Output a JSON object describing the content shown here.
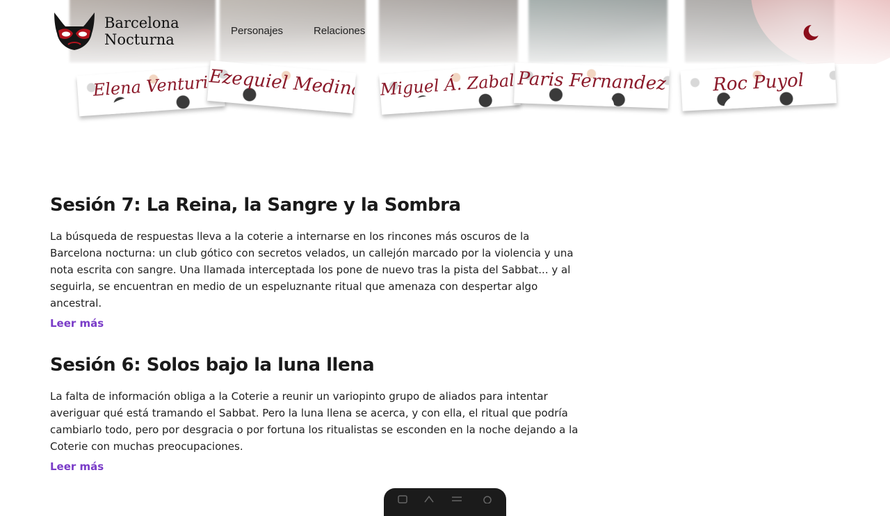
{
  "header": {
    "brand_line1": "Barcelona",
    "brand_line2": "Nocturna",
    "nav": [
      "Personajes",
      "Relaciones"
    ],
    "theme_toggle_icon": "moon-icon",
    "accent_color": "#8b0d1a"
  },
  "characters": [
    "Elena Venturi",
    "Ezequiel Medina",
    "Miguel Á. Zabaleta",
    "Paris Fernandez",
    "Roc Puyol"
  ],
  "articles": [
    {
      "title": "Sesión 7: La Reina, la Sangre y la Sombra",
      "summary": "La búsqueda de respuestas lleva a la coterie a internarse en los rincones más oscuros de la Barcelona nocturna: un club gótico con secretos velados, un callejón marcado por la violencia y una nota escrita con sangre. Una llamada interceptada los pone de nuevo tras la pista del Sabbat... y al seguirla, se encuentran en medio de un espeluznante ritual que amenaza con despertar algo ancestral.",
      "read_more": "Leer más"
    },
    {
      "title": "Sesión 6: Solos bajo la luna llena",
      "summary": "La falta de información obliga a la Coterie a reunir un variopinto grupo de aliados para intentar averiguar qué está tramando el Sabbat. Pero la luna llena se acerca, y con ella, el ritual que podría cambiarlo todo, pero por desgracia o por fortuna los ritualistas se esconden en la noche dejando a la Coterie con muchas preocupaciones.",
      "read_more": "Leer más"
    }
  ],
  "colors": {
    "link": "#7a3cc8",
    "card_name": "#8b1a2a"
  }
}
